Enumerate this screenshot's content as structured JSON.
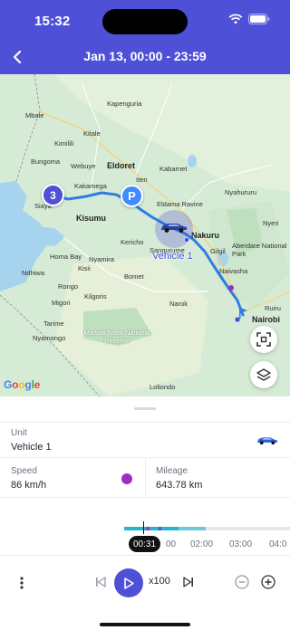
{
  "status_bar": {
    "time": "15:32",
    "icons": [
      "wifi-icon",
      "battery-icon"
    ]
  },
  "header": {
    "title": "Jan 13, 00:00 - 23:59",
    "back_icon": "chevron-left-icon"
  },
  "map": {
    "places": [
      {
        "name": "Mbale",
        "big": false
      },
      {
        "name": "Kapenguria",
        "big": false
      },
      {
        "name": "Kimilili",
        "big": false
      },
      {
        "name": "Bungoma",
        "big": false
      },
      {
        "name": "Webuye",
        "big": false
      },
      {
        "name": "Kitale",
        "big": false
      },
      {
        "name": "Eldoret",
        "big": true
      },
      {
        "name": "Kabarnet",
        "big": false
      },
      {
        "name": "Iten",
        "big": false
      },
      {
        "name": "Kakamega",
        "big": false
      },
      {
        "name": "Siaya",
        "big": false
      },
      {
        "name": "Kisumu",
        "big": true
      },
      {
        "name": "Eldama Ravine",
        "big": false
      },
      {
        "name": "Kericho",
        "big": false
      },
      {
        "name": "Homa Bay",
        "big": false
      },
      {
        "name": "Kisii",
        "big": false
      },
      {
        "name": "Nyamira",
        "big": false
      },
      {
        "name": "Bomet",
        "big": false
      },
      {
        "name": "Narok",
        "big": false
      },
      {
        "name": "Nakuru",
        "big": true
      },
      {
        "name": "Gilgil",
        "big": false
      },
      {
        "name": "Naivasha",
        "big": false
      },
      {
        "name": "Aberdare National Park",
        "big": false
      },
      {
        "name": "Nyeri",
        "big": false
      },
      {
        "name": "Ruiru",
        "big": false
      },
      {
        "name": "Nairobi",
        "big": true
      },
      {
        "name": "Ndhiwa",
        "big": false
      },
      {
        "name": "Rongo",
        "big": false
      },
      {
        "name": "Migori",
        "big": false
      },
      {
        "name": "Kilgoris",
        "big": false
      },
      {
        "name": "Tarime",
        "big": false
      },
      {
        "name": "Nyamongo",
        "big": false
      },
      {
        "name": "Maasai Mara National Reserve",
        "big": false
      },
      {
        "name": "Loliondo",
        "big": false
      },
      {
        "name": "Sangurume",
        "big": false
      },
      {
        "name": "Nyahururu",
        "big": false
      }
    ],
    "stop_count_marker": "3",
    "parking_marker": "P",
    "vehicle_label": "Vehicle 1",
    "attribution": "Google",
    "colors": {
      "route": "#2f7de1",
      "halo": "#4f50d8",
      "water": "#a6d4ee"
    }
  },
  "details": {
    "unit_label": "Unit",
    "unit_value": "Vehicle 1",
    "speed_label": "Speed",
    "speed_value": "86 km/h",
    "speed_color": "#9b2fc4",
    "mileage_label": "Mileage",
    "mileage_value": "643.78 km"
  },
  "timeline": {
    "current_time": "00:31",
    "ticks": [
      "00",
      "02:00",
      "03:00",
      "04:0"
    ],
    "colors": {
      "track": "#25b6c9",
      "accent": "#8f40c8"
    }
  },
  "controls": {
    "more_icon": "more-vertical-icon",
    "prev_icon": "skip-previous-icon",
    "play_icon": "play-icon",
    "speed_multiplier": "x100",
    "next_icon": "skip-next-icon",
    "zoom_out_icon": "zoom-out-icon",
    "zoom_in_icon": "zoom-in-icon"
  }
}
